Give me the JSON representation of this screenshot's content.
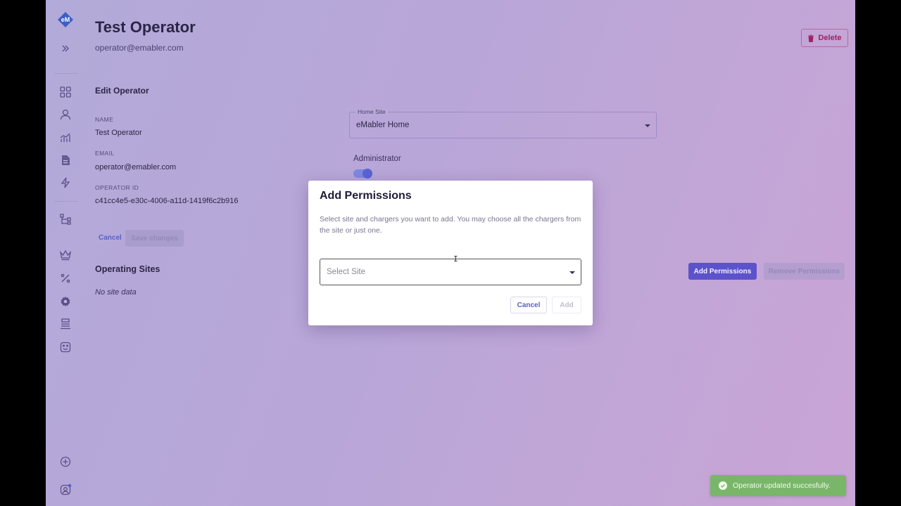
{
  "header": {
    "title": "Test Operator",
    "email": "operator@emabler.com",
    "delete_label": "Delete"
  },
  "edit": {
    "section_title": "Edit Operator",
    "name_label": "NAME",
    "name_value": "Test Operator",
    "email_label": "EMAIL",
    "email_value": "operator@emabler.com",
    "id_label": "OPERATOR ID",
    "id_value": "c41cc4e5-e30c-4006-a11d-1419f6c2b916",
    "home_site_label": "Home Site",
    "home_site_value": "eMabler Home",
    "admin_label": "Administrator",
    "admin_enabled": true,
    "cancel_label": "Cancel",
    "save_label": "Save changes"
  },
  "sites": {
    "title": "Operating Sites",
    "empty_text": "No site data",
    "add_label": "Add Permissions",
    "remove_label": "Remove Permissions"
  },
  "modal": {
    "title": "Add Permissions",
    "description": "Select site and chargers you want to add. You may choose all the chargers from the site or just one.",
    "select_placeholder": "Select Site",
    "cancel_label": "Cancel",
    "add_label": "Add"
  },
  "toast": {
    "message": "Operator updated succesfully."
  },
  "sidebar": {
    "icons": [
      "expand-icon",
      "dashboard-icon",
      "user-icon",
      "analytics-icon",
      "document-icon",
      "lightning-icon",
      "hierarchy-icon",
      "crown-icon",
      "percent-icon",
      "settings-icon",
      "stack-icon",
      "emoji-icon",
      "plus-circle-icon",
      "account-icon"
    ]
  },
  "colors": {
    "primary": "#5c52cc",
    "danger": "#a0225f",
    "success": "#7ab66a"
  }
}
